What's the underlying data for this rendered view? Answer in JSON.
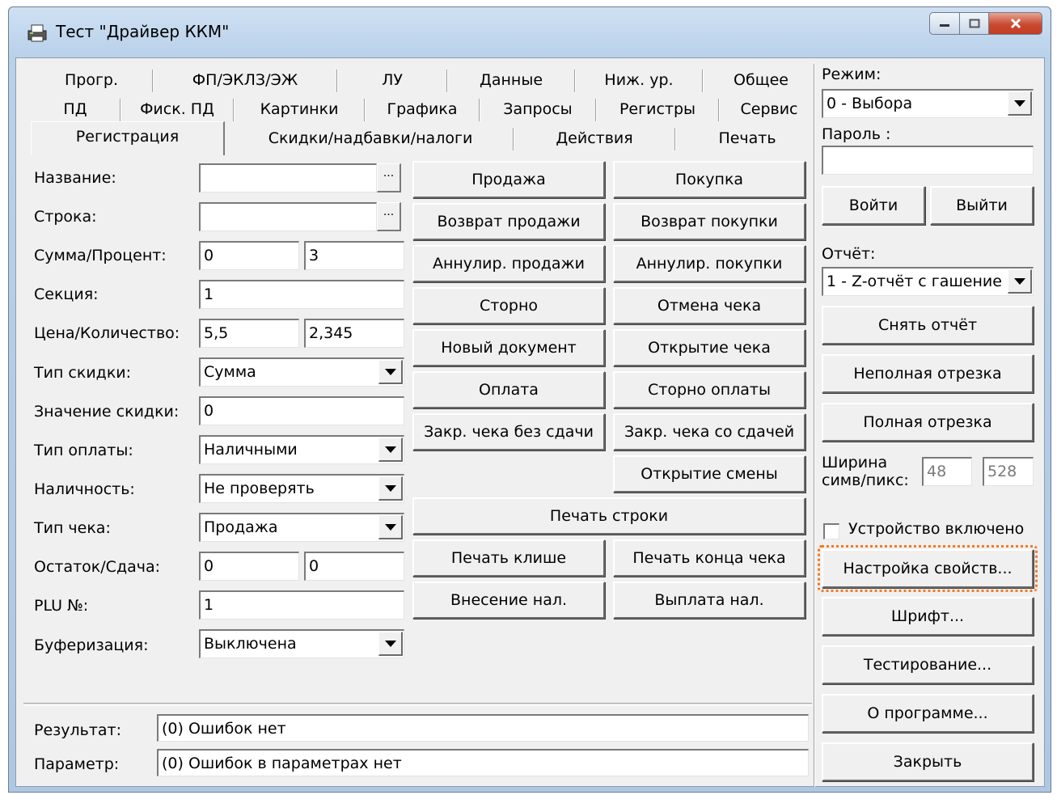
{
  "window": {
    "title": "Тест \"Драйвер ККМ\"",
    "icon": "printer-app-icon"
  },
  "tabs": {
    "row1": [
      "Прогр.",
      "ФП/ЭКЛЗ/ЭЖ",
      "ЛУ",
      "Данные",
      "Ниж. ур.",
      "Общее"
    ],
    "row2": [
      "ПД",
      "Фиск. ПД",
      "Картинки",
      "Графика",
      "Запросы",
      "Регистры",
      "Сервис"
    ],
    "row3": [
      "Регистрация",
      "Скидки/надбавки/налоги",
      "Действия",
      "Печать"
    ],
    "active": "Регистрация"
  },
  "form": {
    "name_label": "Название:",
    "line_label": "Строка:",
    "sum_label": "Сумма/Процент:",
    "sum_value": "0",
    "percent_value": "3",
    "section_label": "Секция:",
    "section_value": "1",
    "price_label": "Цена/Количество:",
    "price_value": "5,5",
    "qty_value": "2,345",
    "discount_type_label": "Тип скидки:",
    "discount_type_value": "Сумма",
    "discount_value_label": "Значение скидки:",
    "discount_value": "0",
    "payment_type_label": "Тип оплаты:",
    "payment_type_value": "Наличными",
    "cash_label": "Наличность:",
    "cash_value": "Не проверять",
    "receipt_type_label": "Тип чека:",
    "receipt_type_value": "Продажа",
    "rest_label": "Остаток/Сдача:",
    "rest_value": "0",
    "change_value": "0",
    "plu_label": "PLU №:",
    "plu_value": "1",
    "buffer_label": "Буферизация:",
    "buffer_value": "Выключена",
    "ellipsis": "..."
  },
  "actions": {
    "sale": "Продажа",
    "purchase": "Покупка",
    "return_sale": "Возврат продажи",
    "return_purchase": "Возврат покупки",
    "annul_sale": "Аннулир. продажи",
    "annul_purchase": "Аннулир. покупки",
    "storno": "Сторно",
    "cancel_receipt": "Отмена чека",
    "new_document": "Новый документ",
    "open_receipt": "Открытие чека",
    "payment": "Оплата",
    "storno_payment": "Сторно оплаты",
    "close_no_change": "Закр. чека без сдачи",
    "close_with_change": "Закр. чека со сдачей",
    "open_shift": "Открытие смены",
    "print_line": "Печать строки",
    "print_header": "Печать клише",
    "print_footer": "Печать конца чека",
    "cash_in": "Внесение нал.",
    "cash_out": "Выплата нал."
  },
  "result": {
    "result_label": "Результат:",
    "result_value": "(0) Ошибок нет",
    "param_label": "Параметр:",
    "param_value": "(0) Ошибок в параметрах нет"
  },
  "side": {
    "mode_label": "Режим:",
    "mode_value": "0 - Выбора",
    "password_label": "Пароль :",
    "password_value": "",
    "login": "Войти",
    "logout": "Выйти",
    "report_label": "Отчёт:",
    "report_value": "1 - Z-отчёт с гашение",
    "take_report": "Снять отчёт",
    "partial_cut": "Неполная отрезка",
    "full_cut": "Полная отрезка",
    "width_label_1": "Ширина",
    "width_label_2": "симв/пикс:",
    "width_chars": "48",
    "width_pixels": "528",
    "device_enabled": "Устройство включено",
    "properties": "Настройка свойств...",
    "font": "Шрифт...",
    "testing": "Тестирование...",
    "about": "О программе...",
    "close": "Закрыть"
  }
}
